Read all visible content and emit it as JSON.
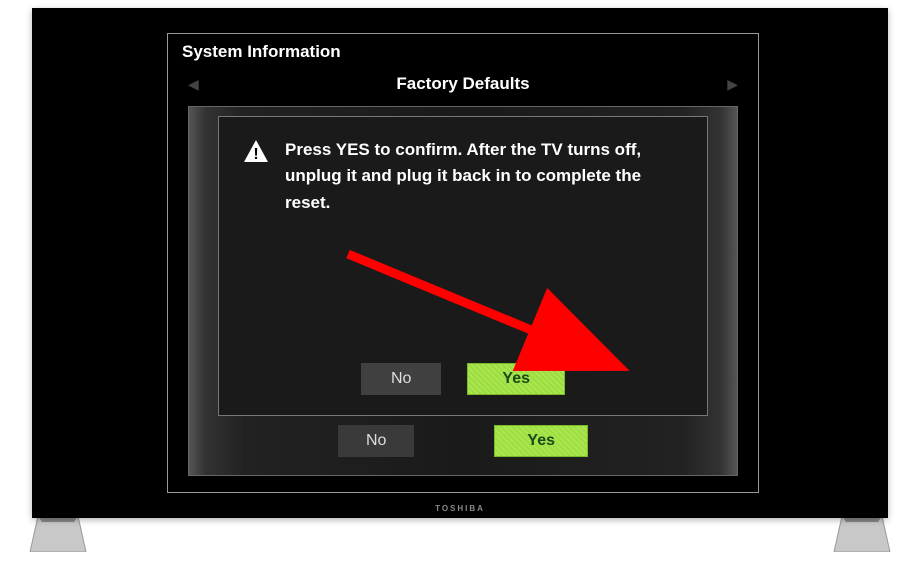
{
  "brand": "TOSHIBA",
  "menu": {
    "title": "System Information",
    "subtitle": "Factory Defaults"
  },
  "dialog": {
    "message": "Press YES to confirm. After the TV turns off, unplug it and plug it back in to complete the reset.",
    "no_label": "No",
    "yes_label": "Yes"
  },
  "back_buttons": {
    "no_label": "No",
    "yes_label": "Yes"
  },
  "icons": {
    "warning": "warning-triangle"
  },
  "colors": {
    "yes_bg": "#a8e84a",
    "no_bg": "#404040",
    "arrow": "#ff0000"
  }
}
